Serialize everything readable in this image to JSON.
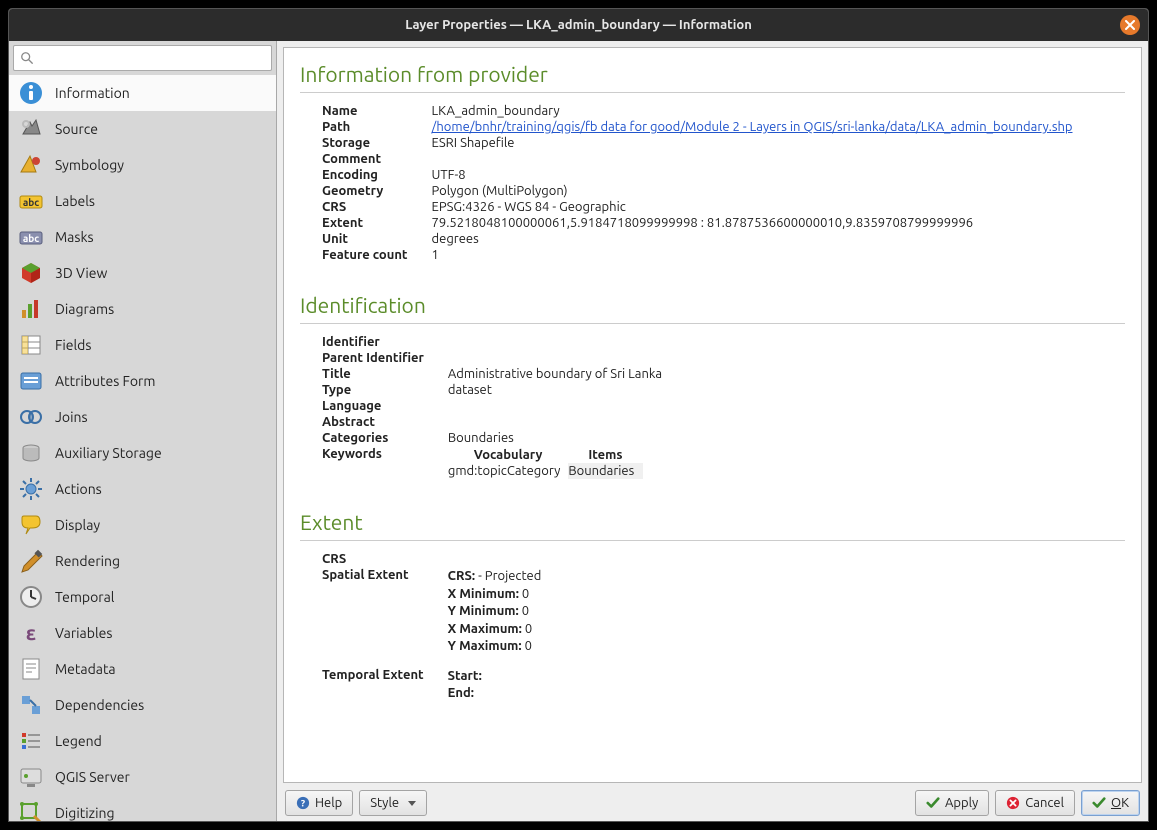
{
  "window": {
    "title": "Layer Properties — LKA_admin_boundary — Information"
  },
  "search": {
    "placeholder": ""
  },
  "sidebar": {
    "items": [
      {
        "id": "information",
        "label": "Information"
      },
      {
        "id": "source",
        "label": "Source"
      },
      {
        "id": "symbology",
        "label": "Symbology"
      },
      {
        "id": "labels",
        "label": "Labels"
      },
      {
        "id": "masks",
        "label": "Masks"
      },
      {
        "id": "3dview",
        "label": "3D View"
      },
      {
        "id": "diagrams",
        "label": "Diagrams"
      },
      {
        "id": "fields",
        "label": "Fields"
      },
      {
        "id": "attributesform",
        "label": "Attributes Form"
      },
      {
        "id": "joins",
        "label": "Joins"
      },
      {
        "id": "auxiliary",
        "label": "Auxiliary Storage"
      },
      {
        "id": "actions",
        "label": "Actions"
      },
      {
        "id": "display",
        "label": "Display"
      },
      {
        "id": "rendering",
        "label": "Rendering"
      },
      {
        "id": "temporal",
        "label": "Temporal"
      },
      {
        "id": "variables",
        "label": "Variables"
      },
      {
        "id": "metadata",
        "label": "Metadata"
      },
      {
        "id": "dependencies",
        "label": "Dependencies"
      },
      {
        "id": "legend",
        "label": "Legend"
      },
      {
        "id": "qgisserver",
        "label": "QGIS Server"
      },
      {
        "id": "digitizing",
        "label": "Digitizing"
      }
    ],
    "selected": "information"
  },
  "sections": {
    "provider": {
      "heading": "Information from provider",
      "rows": {
        "name_k": "Name",
        "name_v": "LKA_admin_boundary",
        "path_k": "Path",
        "path_v": "/home/bnhr/training/qgis/fb data for good/Module 2 - Layers in QGIS/sri-lanka/data/LKA_admin_boundary.shp",
        "storage_k": "Storage",
        "storage_v": "ESRI Shapefile",
        "comment_k": "Comment",
        "comment_v": "",
        "encoding_k": "Encoding",
        "encoding_v": "UTF-8",
        "geometry_k": "Geometry",
        "geometry_v": "Polygon (MultiPolygon)",
        "crs_k": "CRS",
        "crs_v": "EPSG:4326 - WGS 84 - Geographic",
        "extent_k": "Extent",
        "extent_v": "79.5218048100000061,5.9184718099999998 : 81.8787536600000010,9.8359708799999996",
        "unit_k": "Unit",
        "unit_v": "degrees",
        "featcount_k": "Feature count",
        "featcount_v": "1"
      }
    },
    "identification": {
      "heading": "Identification",
      "rows": {
        "identifier_k": "Identifier",
        "identifier_v": "",
        "parent_k": "Parent Identifier",
        "parent_v": "",
        "title_k": "Title",
        "title_v": "Administrative boundary of Sri Lanka",
        "type_k": "Type",
        "type_v": "dataset",
        "language_k": "Language",
        "language_v": "",
        "abstract_k": "Abstract",
        "abstract_v": "",
        "categories_k": "Categories",
        "categories_v": "Boundaries",
        "keywords_k": "Keywords"
      },
      "keywords_table": {
        "col_vocab": "Vocabulary",
        "col_items": "Items",
        "vocab": "gmd:topicCategory",
        "items": "Boundaries"
      }
    },
    "extent": {
      "heading": "Extent",
      "rows": {
        "crs_k": "CRS",
        "crs_v": "",
        "spatial_k": "Spatial Extent",
        "spatial": {
          "crs_label": "CRS:",
          "crs_val": " - Projected",
          "xmin_label": "X Minimum:",
          "xmin_val": " 0",
          "ymin_label": "Y Minimum:",
          "ymin_val": " 0",
          "xmax_label": "X Maximum:",
          "xmax_val": " 0",
          "ymax_label": "Y Maximum:",
          "ymax_val": " 0"
        },
        "temporal_k": "Temporal Extent",
        "temporal": {
          "start_label": "Start:",
          "start_val": "",
          "end_label": "End:",
          "end_val": ""
        }
      }
    }
  },
  "buttons": {
    "help": "Help",
    "style": "Style",
    "apply": "Apply",
    "cancel": "Cancel",
    "ok_prefix": "O",
    "ok_suffix": "K"
  }
}
